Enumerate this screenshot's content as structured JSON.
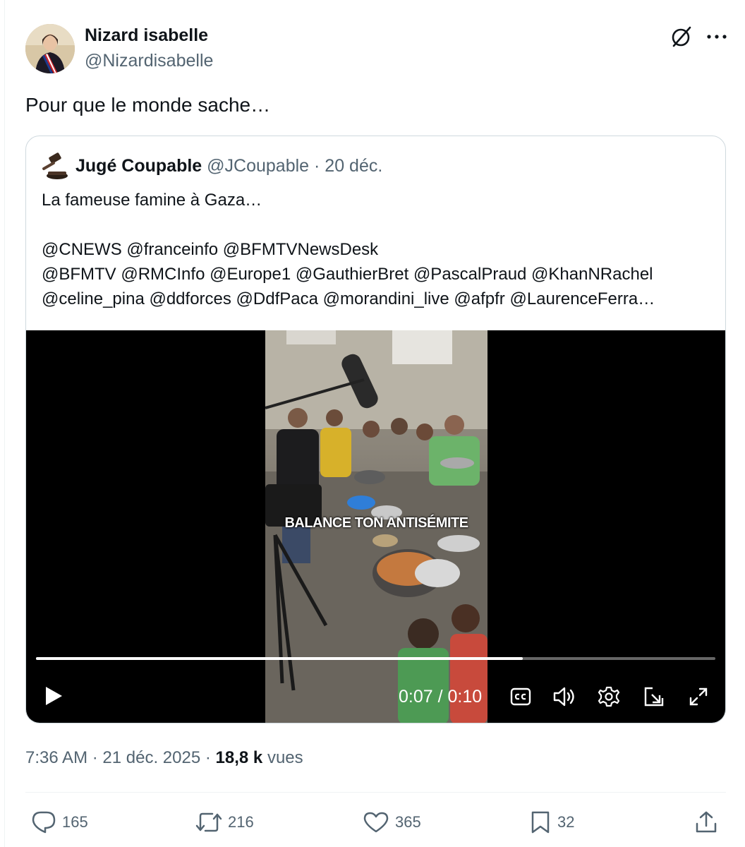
{
  "author": {
    "display_name": "Nizard isabelle",
    "handle": "@Nizardisabelle",
    "avatar_icon": "avatar-photo"
  },
  "post": {
    "text": "Pour que le monde sache…",
    "time": "7:36 AM",
    "date": "21 déc. 2025",
    "views_count": "18,8 k",
    "views_label": "vues"
  },
  "quote": {
    "display_name": "Jugé Coupable",
    "handle": "@JCoupable",
    "separator": "·",
    "date": "20 déc.",
    "lines": [
      "La fameuse famine à Gaza…",
      "@CNEWS @franceinfo @BFMTVNewsDesk",
      "@BFMTV @RMCInfo @Europe1 @GauthierBret @PascalPraud @KhanNRachel",
      "@celine_pina @ddforces @DdfPaca @morandini_live @afpfr @LaurenceFerra…"
    ]
  },
  "video": {
    "overlay_text": "BALANCE TON ANTISÉMITE",
    "current_time": "0:07",
    "duration": "0:10",
    "time_display": "0:07 / 0:10",
    "progress_fraction": 0.717
  },
  "actions": {
    "replies": "165",
    "reposts": "216",
    "likes": "365",
    "bookmarks": "32"
  },
  "colors": {
    "text_primary": "#0f1419",
    "text_secondary": "#536471",
    "border": "#cfd9de",
    "video_bg": "#000000"
  }
}
